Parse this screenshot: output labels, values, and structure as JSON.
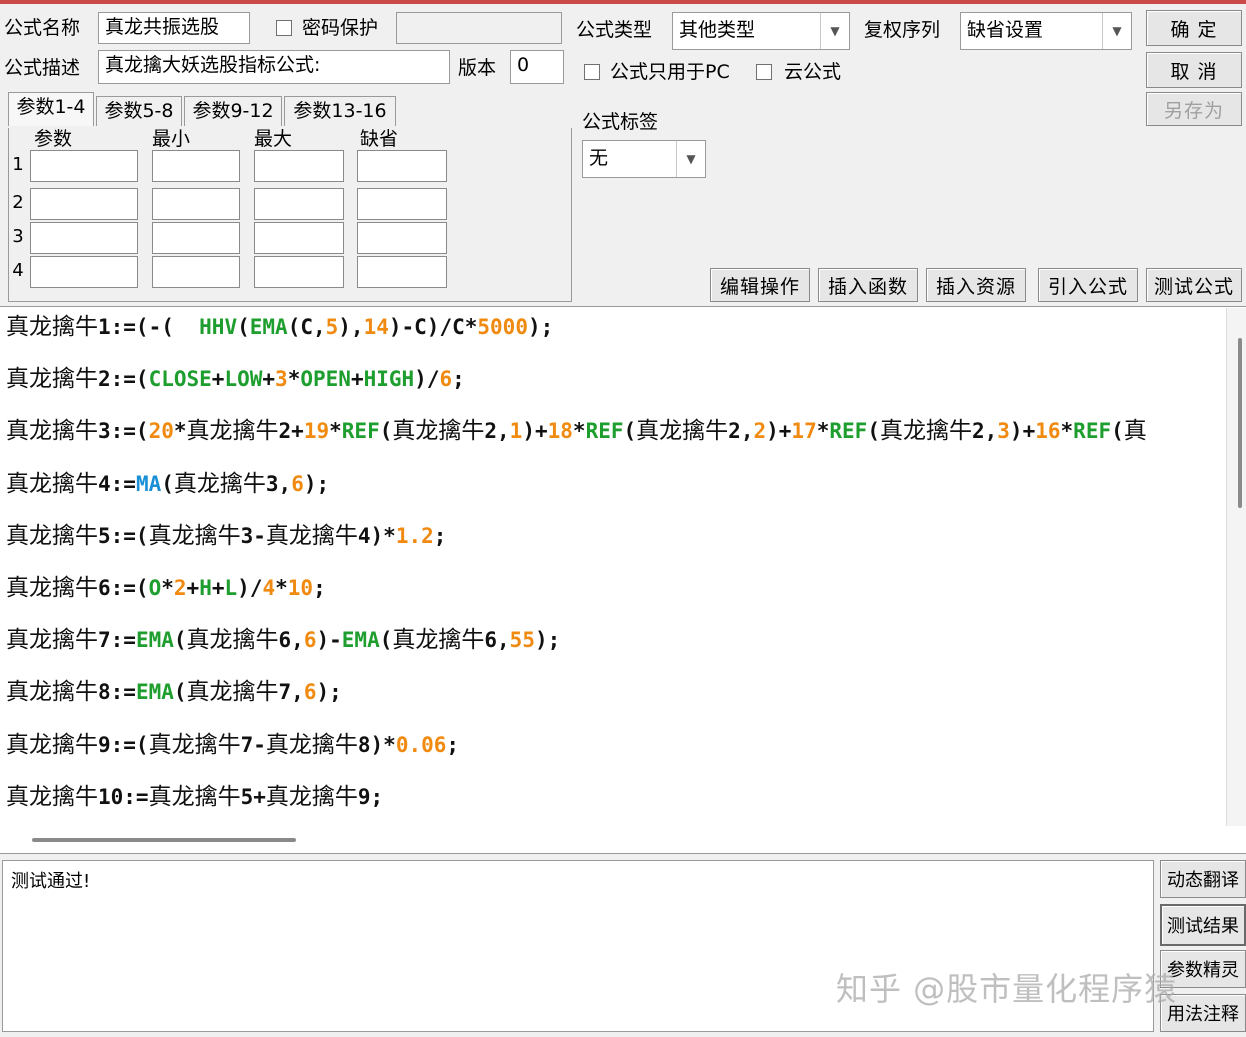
{
  "header": {
    "name_label": "公式名称",
    "name_value": "真龙共振选股",
    "password_label": "密码保护",
    "desc_label": "公式描述",
    "desc_value": "真龙擒大妖选股指标公式:",
    "version_label": "版本",
    "version_value": "0",
    "type_label": "公式类型",
    "type_value": "其他类型",
    "rights_label": "复权序列",
    "rights_value": "缺省设置",
    "pc_only_label": "公式只用于PC",
    "cloud_label": "云公式",
    "tag_label": "公式标签",
    "tag_value": "无"
  },
  "buttons": {
    "ok": "确 定",
    "cancel": "取 消",
    "save_as": "另存为",
    "edit_ops": "编辑操作",
    "insert_func": "插入函数",
    "insert_res": "插入资源",
    "import_formula": "引入公式",
    "test_formula": "测试公式"
  },
  "param_tabs": [
    "参数1-4",
    "参数5-8",
    "参数9-12",
    "参数13-16"
  ],
  "param_columns": [
    "参数",
    "最小",
    "最大",
    "缺省"
  ],
  "param_rows": [
    "1",
    "2",
    "3",
    "4"
  ],
  "code_lines": [
    [
      [
        "真龙擒牛",
        "cn"
      ],
      [
        "1:=(-(  ",
        ""
      ],
      [
        "HHV",
        "g"
      ],
      [
        "(",
        ""
      ],
      [
        "EMA",
        "g"
      ],
      [
        "(C,",
        ""
      ],
      [
        "5",
        "o"
      ],
      [
        "),",
        ""
      ],
      [
        "14",
        "o"
      ],
      [
        ")-C)/C*",
        ""
      ],
      [
        "5000",
        "o"
      ],
      [
        ");",
        ""
      ]
    ],
    [
      [
        "真龙擒牛",
        "cn"
      ],
      [
        "2:=(",
        ""
      ],
      [
        "CLOSE",
        "g"
      ],
      [
        "+",
        ""
      ],
      [
        "LOW",
        "g"
      ],
      [
        "+",
        ""
      ],
      [
        "3",
        "o"
      ],
      [
        "*",
        ""
      ],
      [
        "OPEN",
        "g"
      ],
      [
        "+",
        ""
      ],
      [
        "HIGH",
        "g"
      ],
      [
        ")/",
        ""
      ],
      [
        "6",
        "o"
      ],
      [
        ";",
        ""
      ]
    ],
    [
      [
        "真龙擒牛",
        "cn"
      ],
      [
        "3:=(",
        ""
      ],
      [
        "20",
        "o"
      ],
      [
        "*",
        ""
      ],
      [
        "真龙擒牛",
        "cn"
      ],
      [
        "2+",
        ""
      ],
      [
        "19",
        "o"
      ],
      [
        "*",
        ""
      ],
      [
        "REF",
        "g"
      ],
      [
        "(",
        ""
      ],
      [
        "真龙擒牛",
        "cn"
      ],
      [
        "2,",
        ""
      ],
      [
        "1",
        "o"
      ],
      [
        ")+",
        ""
      ],
      [
        "18",
        "o"
      ],
      [
        "*",
        ""
      ],
      [
        "REF",
        "g"
      ],
      [
        "(",
        ""
      ],
      [
        "真龙擒牛",
        "cn"
      ],
      [
        "2,",
        ""
      ],
      [
        "2",
        "o"
      ],
      [
        ")+",
        ""
      ],
      [
        "17",
        "o"
      ],
      [
        "*",
        ""
      ],
      [
        "REF",
        "g"
      ],
      [
        "(",
        ""
      ],
      [
        "真龙擒牛",
        "cn"
      ],
      [
        "2,",
        ""
      ],
      [
        "3",
        "o"
      ],
      [
        ")+",
        ""
      ],
      [
        "16",
        "o"
      ],
      [
        "*",
        ""
      ],
      [
        "REF",
        "g"
      ],
      [
        "(",
        ""
      ],
      [
        "真",
        "cn"
      ]
    ],
    [
      [
        "真龙擒牛",
        "cn"
      ],
      [
        "4:=",
        ""
      ],
      [
        "MA",
        "b"
      ],
      [
        "(",
        ""
      ],
      [
        "真龙擒牛",
        "cn"
      ],
      [
        "3,",
        ""
      ],
      [
        "6",
        "o"
      ],
      [
        ");",
        ""
      ]
    ],
    [
      [
        "真龙擒牛",
        "cn"
      ],
      [
        "5:=(",
        ""
      ],
      [
        "真龙擒牛",
        "cn"
      ],
      [
        "3-",
        ""
      ],
      [
        "真龙擒牛",
        "cn"
      ],
      [
        "4)*",
        ""
      ],
      [
        "1.2",
        "o"
      ],
      [
        ";",
        ""
      ]
    ],
    [
      [
        "真龙擒牛",
        "cn"
      ],
      [
        "6:=(",
        ""
      ],
      [
        "O",
        "g"
      ],
      [
        "*",
        ""
      ],
      [
        "2",
        "o"
      ],
      [
        "+",
        ""
      ],
      [
        "H",
        "g"
      ],
      [
        "+",
        ""
      ],
      [
        "L",
        "g"
      ],
      [
        ")/",
        ""
      ],
      [
        "4",
        "o"
      ],
      [
        "*",
        ""
      ],
      [
        "10",
        "o"
      ],
      [
        ";",
        ""
      ]
    ],
    [
      [
        "真龙擒牛",
        "cn"
      ],
      [
        "7:=",
        ""
      ],
      [
        "EMA",
        "g"
      ],
      [
        "(",
        ""
      ],
      [
        "真龙擒牛",
        "cn"
      ],
      [
        "6,",
        ""
      ],
      [
        "6",
        "o"
      ],
      [
        ")-",
        ""
      ],
      [
        "EMA",
        "g"
      ],
      [
        "(",
        ""
      ],
      [
        "真龙擒牛",
        "cn"
      ],
      [
        "6,",
        ""
      ],
      [
        "55",
        "o"
      ],
      [
        ");",
        ""
      ]
    ],
    [
      [
        "真龙擒牛",
        "cn"
      ],
      [
        "8:=",
        ""
      ],
      [
        "EMA",
        "g"
      ],
      [
        "(",
        ""
      ],
      [
        "真龙擒牛",
        "cn"
      ],
      [
        "7,",
        ""
      ],
      [
        "6",
        "o"
      ],
      [
        ");",
        ""
      ]
    ],
    [
      [
        "真龙擒牛",
        "cn"
      ],
      [
        "9:=(",
        ""
      ],
      [
        "真龙擒牛",
        "cn"
      ],
      [
        "7-",
        ""
      ],
      [
        "真龙擒牛",
        "cn"
      ],
      [
        "8)*",
        ""
      ],
      [
        "0.06",
        "o"
      ],
      [
        ";",
        ""
      ]
    ],
    [
      [
        "真龙擒牛",
        "cn"
      ],
      [
        "10:=",
        ""
      ],
      [
        "真龙擒牛",
        "cn"
      ],
      [
        "5+",
        ""
      ],
      [
        "真龙擒牛",
        "cn"
      ],
      [
        "9;",
        ""
      ]
    ]
  ],
  "result": {
    "message": "测试通过!"
  },
  "side_buttons": [
    "动态翻译",
    "测试结果",
    "参数精灵",
    "用法注释"
  ],
  "watermark": "知乎 @股市量化程序猿",
  "colors": {
    "function_green": "#1e9e2e",
    "number_orange": "#f08a10",
    "ma_blue": "#1a8fd6",
    "top_accent": "#c94a4a"
  }
}
